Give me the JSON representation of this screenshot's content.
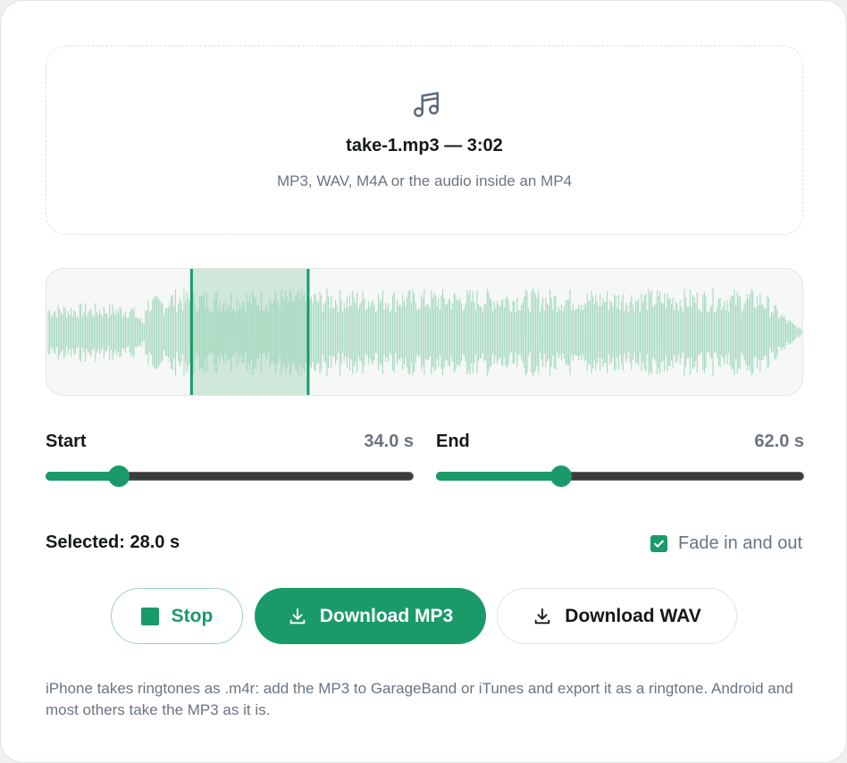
{
  "dropzone": {
    "icon": "music-note-icon",
    "file_name": "take-1.mp3 — 3:02",
    "hint": "MP3, WAV, M4A or the audio inside an MP4"
  },
  "waveform": {
    "duration_s": 182,
    "selection_start_s": 34.0,
    "selection_end_s": 62.0,
    "colors": {
      "wave": "#9fd6bb",
      "selection_bg": "#cfe8da",
      "selection_edge": "#1a9a68"
    }
  },
  "start": {
    "label": "Start",
    "value": "34.0 s",
    "fraction": 0.2
  },
  "end": {
    "label": "End",
    "value": "62.0 s",
    "fraction": 0.34
  },
  "selected_text": "Selected: 28.0 s",
  "fade": {
    "label": "Fade in and out",
    "checked": true
  },
  "buttons": {
    "stop": "Stop",
    "download_mp3": "Download MP3",
    "download_wav": "Download WAV"
  },
  "footer_note": "iPhone takes ringtones as .m4r: add the MP3 to GarageBand or iTunes and export it as a ringtone. Android and most others take the MP3 as it is.",
  "colors": {
    "accent": "#1a9a68",
    "muted_text": "#6b7480",
    "text": "#14181a"
  }
}
